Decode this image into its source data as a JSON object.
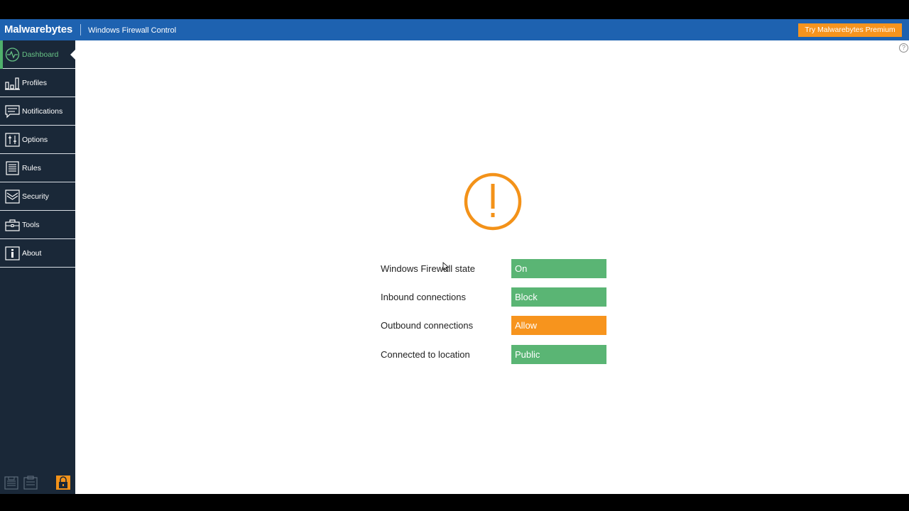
{
  "titlebar": {
    "logo_text": "Malwarebytes",
    "app_title": "Windows Firewall Control",
    "premium_button": "Try Malwarebytes Premium",
    "bg_color": "#1e62b0",
    "premium_color": "#f7941d"
  },
  "sidebar": {
    "items": [
      {
        "label": "Dashboard",
        "icon": "pulse-icon",
        "active": true
      },
      {
        "label": "Profiles",
        "icon": "bars-icon"
      },
      {
        "label": "Notifications",
        "icon": "message-icon"
      },
      {
        "label": "Options",
        "icon": "sliders-icon"
      },
      {
        "label": "Rules",
        "icon": "list-icon"
      },
      {
        "label": "Security",
        "icon": "shield-icon"
      },
      {
        "label": "Tools",
        "icon": "toolbox-icon"
      },
      {
        "label": "About",
        "icon": "info-icon"
      }
    ],
    "bottom_icons": [
      "save-icon",
      "clipboard-icon",
      "lock-icon"
    ],
    "accent_color": "#4fb06c"
  },
  "help": {
    "glyph": "?"
  },
  "status": {
    "icon": "warning-icon",
    "icon_color": "#f39219",
    "rows": [
      {
        "label": "Windows Firewall state",
        "value": "On",
        "color": "#5ab574"
      },
      {
        "label": "Inbound connections",
        "value": "Block",
        "color": "#5ab574"
      },
      {
        "label": "Outbound connections",
        "value": "Allow",
        "color": "#f7941d"
      },
      {
        "label": "Connected to location",
        "value": "Public",
        "color": "#5ab574"
      }
    ]
  }
}
